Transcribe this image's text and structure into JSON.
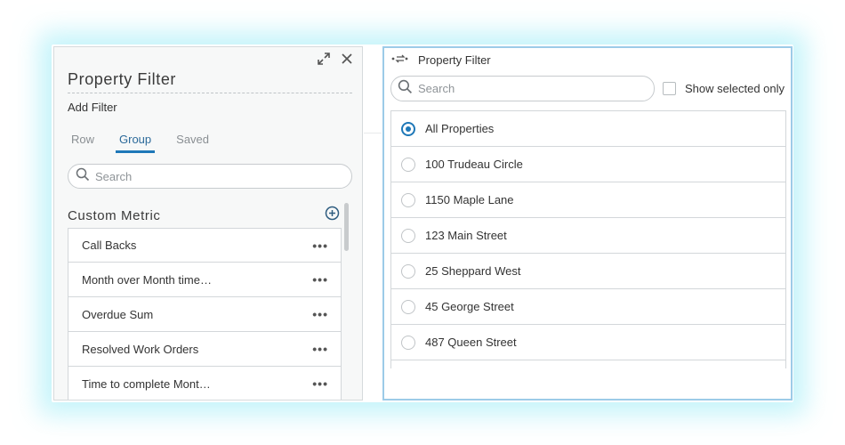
{
  "left_panel": {
    "title": "Property Filter",
    "subtitle": "Add Filter",
    "icons": [
      "expand-icon",
      "close-icon"
    ],
    "tabs": [
      {
        "label": "Row",
        "active": false
      },
      {
        "label": "Group",
        "active": true
      },
      {
        "label": "Saved",
        "active": false
      }
    ],
    "search": {
      "placeholder": "Search",
      "value": ""
    },
    "section": {
      "title": "Custom Metric",
      "add_icon": "plus-circle-icon"
    },
    "items": [
      {
        "label": "Call Backs"
      },
      {
        "label": "Month over Month time…"
      },
      {
        "label": "Overdue Sum"
      },
      {
        "label": "Resolved Work Orders"
      },
      {
        "label": "Time to complete Mont…"
      }
    ],
    "more_glyph": "•••"
  },
  "right_panel": {
    "title": "Property Filter",
    "header_icon": "link-arrows-icon",
    "search": {
      "placeholder": "Search",
      "value": ""
    },
    "show_selected_label": "Show selected only",
    "show_selected_checked": false,
    "options": [
      {
        "label": "All Properties",
        "selected": true
      },
      {
        "label": "100 Trudeau Circle",
        "selected": false
      },
      {
        "label": "1150 Maple Lane",
        "selected": false
      },
      {
        "label": "123 Main Street",
        "selected": false
      },
      {
        "label": "25 Sheppard West",
        "selected": false
      },
      {
        "label": "45 George Street",
        "selected": false
      },
      {
        "label": "487 Queen Street",
        "selected": false
      }
    ]
  },
  "colors": {
    "accent": "#1e78b8",
    "panel_border": "#9ccbe8",
    "glow": "#96ebf5",
    "active_tab_text": "#2c6a9a"
  }
}
